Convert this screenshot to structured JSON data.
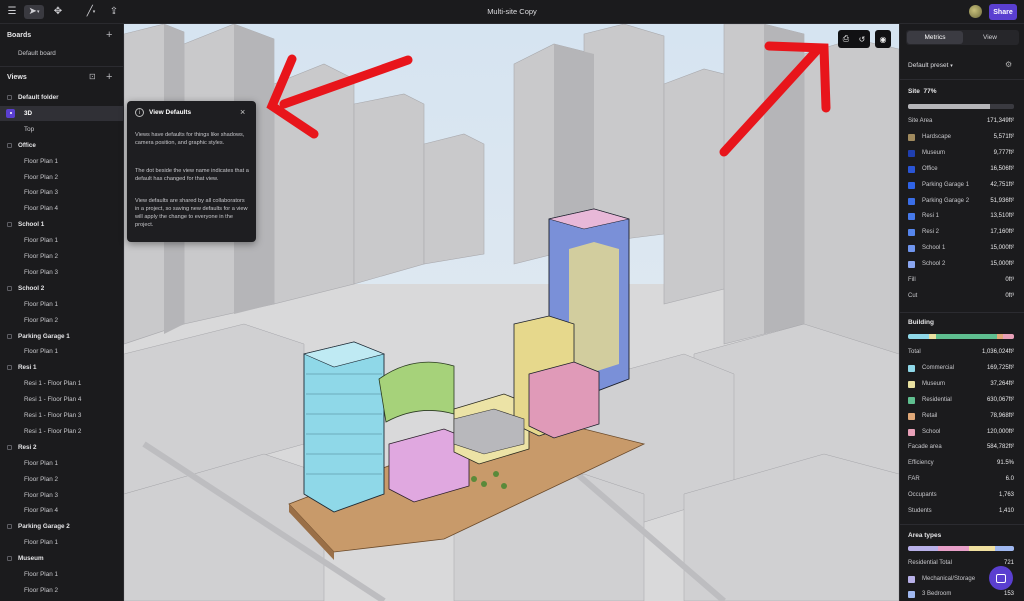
{
  "title": "Multi-site Copy",
  "share_label": "Share",
  "boards": {
    "heading": "Boards",
    "items": [
      "Default board"
    ]
  },
  "views": {
    "heading": "Views",
    "items": [
      {
        "label": "Default folder",
        "level": 0
      },
      {
        "label": "3D",
        "level": 1,
        "selected": true
      },
      {
        "label": "Top",
        "level": 1
      },
      {
        "label": "Office",
        "level": 0
      },
      {
        "label": "Floor Plan 1",
        "level": 1
      },
      {
        "label": "Floor Plan 2",
        "level": 1
      },
      {
        "label": "Floor Plan 3",
        "level": 1
      },
      {
        "label": "Floor Plan 4",
        "level": 1
      },
      {
        "label": "School 1",
        "level": 0
      },
      {
        "label": "Floor Plan 1",
        "level": 1
      },
      {
        "label": "Floor Plan 2",
        "level": 1
      },
      {
        "label": "Floor Plan 3",
        "level": 1
      },
      {
        "label": "School 2",
        "level": 0
      },
      {
        "label": "Floor Plan 1",
        "level": 1
      },
      {
        "label": "Floor Plan 2",
        "level": 1
      },
      {
        "label": "Parking Garage 1",
        "level": 0
      },
      {
        "label": "Floor Plan 1",
        "level": 1
      },
      {
        "label": "Resi 1",
        "level": 0
      },
      {
        "label": "Resi 1 - Floor Plan 1",
        "level": 1
      },
      {
        "label": "Resi 1 - Floor Plan 4",
        "level": 1
      },
      {
        "label": "Resi 1 - Floor Plan 3",
        "level": 1
      },
      {
        "label": "Resi 1 - Floor Plan 2",
        "level": 1
      },
      {
        "label": "Resi 2",
        "level": 0
      },
      {
        "label": "Floor Plan 1",
        "level": 1
      },
      {
        "label": "Floor Plan 2",
        "level": 1
      },
      {
        "label": "Floor Plan 3",
        "level": 1
      },
      {
        "label": "Floor Plan 4",
        "level": 1
      },
      {
        "label": "Parking Garage 2",
        "level": 0
      },
      {
        "label": "Floor Plan 1",
        "level": 1
      },
      {
        "label": "Museum",
        "level": 0
      },
      {
        "label": "Floor Plan 1",
        "level": 1
      },
      {
        "label": "Floor Plan 2",
        "level": 1
      }
    ]
  },
  "tooltip": {
    "title": "View Defaults",
    "p1": "Views have defaults for things like shadows, camera position, and graphic styles.",
    "p2": "The dot beside the view name indicates that a default has changed for that view.",
    "p3": "View defaults are shared by all collaborators in a project, so saving new defaults for a view will apply the change to everyone in the project."
  },
  "right": {
    "tabs": [
      "Metrics",
      "View"
    ],
    "preset": "Default preset",
    "site": {
      "heading": "Site",
      "percent": "77%",
      "fill_fraction": 0.77,
      "rows": [
        {
          "label": "Site Area",
          "value": "171,349ft²"
        },
        {
          "label": "Hardscape",
          "value": "5,571ft²",
          "color": "#a08a5e"
        },
        {
          "label": "Museum",
          "value": "9,777ft²",
          "color": "#1f3fb0"
        },
        {
          "label": "Office",
          "value": "16,506ft²",
          "color": "#2a55d6"
        },
        {
          "label": "Parking Garage 1",
          "value": "42,751ft²",
          "color": "#2f63e6"
        },
        {
          "label": "Parking Garage 2",
          "value": "51,936ft²",
          "color": "#3a6ee8"
        },
        {
          "label": "Resi 1",
          "value": "13,510ft²",
          "color": "#4679ea"
        },
        {
          "label": "Resi 2",
          "value": "17,160ft²",
          "color": "#5585ec"
        },
        {
          "label": "School 1",
          "value": "15,000ft²",
          "color": "#6f95ee"
        },
        {
          "label": "School 2",
          "value": "15,000ft²",
          "color": "#8aa6f0"
        },
        {
          "label": "Fill",
          "value": "0ft³"
        },
        {
          "label": "Cut",
          "value": "0ft³"
        }
      ]
    },
    "building": {
      "heading": "Building",
      "rows": [
        {
          "label": "Total",
          "value": "1,036,024ft²"
        },
        {
          "label": "Commercial",
          "value": "169,725ft²",
          "color": "#8fd8e8"
        },
        {
          "label": "Museum",
          "value": "37,264ft²",
          "color": "#e8e0a0"
        },
        {
          "label": "Residential",
          "value": "630,067ft²",
          "color": "#5fbf90"
        },
        {
          "label": "Retail",
          "value": "78,968ft²",
          "color": "#e0a878"
        },
        {
          "label": "School",
          "value": "120,000ft²",
          "color": "#e8a0b8"
        },
        {
          "label": "Facade area",
          "value": "584,782ft²"
        },
        {
          "label": "Efficiency",
          "value": "91.5%"
        },
        {
          "label": "FAR",
          "value": "6.0"
        },
        {
          "label": "Occupants",
          "value": "1,763"
        },
        {
          "label": "Students",
          "value": "1,410"
        }
      ]
    },
    "area_types": {
      "heading": "Area types",
      "rows": [
        {
          "label": "Residential Total",
          "value": "721"
        },
        {
          "label": "Mechanical/Storage",
          "value": "",
          "color": "#b8b0e8"
        },
        {
          "label": "3 Bedroom",
          "value": "153",
          "color": "#a0b8f0"
        }
      ]
    }
  }
}
